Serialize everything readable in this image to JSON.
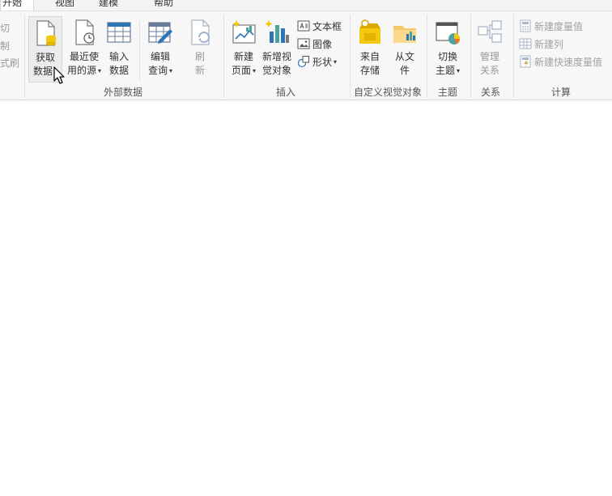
{
  "tabs": [
    {
      "label": "开始",
      "active": true
    },
    {
      "label": "视图",
      "active": false
    },
    {
      "label": "建模",
      "active": false
    },
    {
      "label": "帮助",
      "active": false
    }
  ],
  "clipboard_cut": {
    "c1": "切",
    "c2": "制",
    "c3": "式刷"
  },
  "groups": {
    "external_data": "外部数据",
    "insert": "插入",
    "custom_visuals": "自定义视觉对象",
    "themes": "主题",
    "relationships": "关系",
    "calculations": "计算"
  },
  "buttons": {
    "get_data": {
      "l1": "获取",
      "l2": "数据"
    },
    "recent_sources": {
      "l1": "最近使",
      "l2": "用的源"
    },
    "enter_data": {
      "l1": "输入",
      "l2": "数据"
    },
    "edit_queries": {
      "l1": "编辑",
      "l2": "查询"
    },
    "refresh": {
      "l1": "刷",
      "l2": "新"
    },
    "new_page": {
      "l1": "新建",
      "l2": "页面"
    },
    "new_visual": {
      "l1": "新增视",
      "l2": "觉对象"
    },
    "text_box": "文本框",
    "image": "图像",
    "shapes": "形状",
    "from_store": {
      "l1": "来自",
      "l2": "存储"
    },
    "from_file": {
      "l1": "从文",
      "l2": "件"
    },
    "switch_theme": {
      "l1": "切换",
      "l2": "主题"
    },
    "manage_relationships": {
      "l1": "管理",
      "l2": "关系"
    },
    "new_measure": "新建度量值",
    "new_column": "新建列",
    "new_quick_measure": "新建快速度量值"
  },
  "colors": {
    "accent": "#f2c811",
    "blue": "#2e75b6",
    "teal": "#4aa3a0"
  }
}
